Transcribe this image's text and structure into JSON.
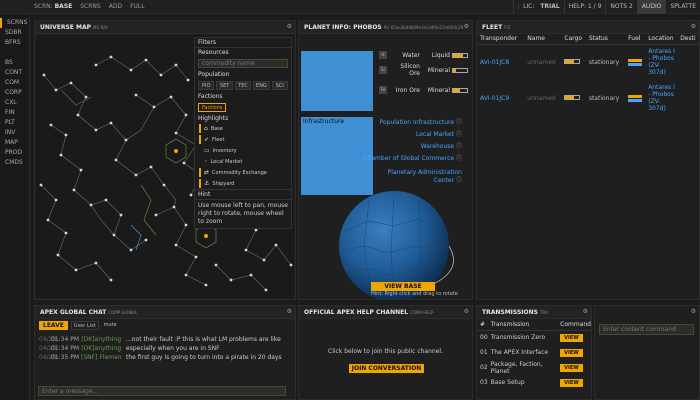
{
  "topbar": {
    "screen_prefix": "SCRN:",
    "screen_name": "BASE",
    "buttons": [
      "SCRNS",
      "ADD",
      "FULL"
    ],
    "right": {
      "lic_prefix": "LIC:",
      "lic": "TRIAL",
      "help": "HELP: 1 / 9",
      "nots": "NOTS 2",
      "audio": "AUDIO",
      "splatter": "SPLATTE"
    }
  },
  "sidebar": {
    "group1": [
      "SCRNS",
      "SDBR",
      "BFRS"
    ],
    "group2": [
      "BS",
      "CONT",
      "COM",
      "CORP",
      "CXL",
      "FIN",
      "PLT",
      "INV",
      "MAP",
      "PROD",
      "CMDS"
    ]
  },
  "universe": {
    "title": "UNIVERSE MAP",
    "subtitle": "MU N/V",
    "filters": {
      "header": "Filters",
      "resources_label": "Resources",
      "commodity_placeholder": "commodity name",
      "population_label": "Population",
      "pop_buttons": [
        "PIO",
        "SET",
        "TEC",
        "ENG",
        "SCI"
      ],
      "factions_label": "Factions",
      "factions_button": "Factions",
      "highlights_label": "Highlights",
      "highlights": [
        "Base",
        "Fleet",
        "Inventory",
        "Local Market",
        "Commodity Exchange",
        "Shipyard"
      ],
      "hint_label": "Hint",
      "hint_text": "Use mouse left to pan, mouse right to rotate, mouse wheel to zoom"
    }
  },
  "planet": {
    "title": "PLANET INFO: PHOBOS",
    "subtitle": "PLI 65ae2bd4b09e1ec3df0e15c6fd4c29",
    "resources": [
      {
        "name": "Water",
        "type": "Liquid",
        "level": 0.7
      },
      {
        "name": "Silicon Ore",
        "type": "Mineral",
        "level": 0.2
      },
      {
        "name": "Iron Ore",
        "type": "Mineral",
        "level": 0.5
      }
    ],
    "infrastructure_label": "Infrastructure",
    "infrastructure": [
      "Population Infrastructure",
      "Local Market",
      "Warehouse",
      "Chamber of Global Commerce",
      "Planetary Administration Center"
    ],
    "view_base": "VIEW BASE",
    "globe_hint": "Hint: Right click and drag to rotate"
  },
  "fleet": {
    "title": "FLEET",
    "subtitle": "FLT",
    "columns": [
      "Transponder",
      "Name",
      "Cargo",
      "Status",
      "Fuel",
      "Location",
      "Desti"
    ],
    "rows": [
      {
        "transponder": "AVI-01JC8",
        "name": "unnamed",
        "cargo": 0.6,
        "status": "stationary",
        "location": "Antares I - Phobos (ZV-307d)"
      },
      {
        "transponder": "AVI-01JC9",
        "name": "unnamed",
        "cargo": 0.6,
        "status": "stationary",
        "location": "Antares I - Phobos (ZV-307d)"
      }
    ]
  },
  "chat": {
    "title": "APEX GLOBAL CHAT",
    "subtitle": "COMP GLOBAL",
    "leave": "LEAVE",
    "user_list": "User List",
    "mute": "mute",
    "messages": [
      {
        "date": "04/23",
        "time": "01:34 PM",
        "user": "[DK]anything",
        "text": "...not their fault :P this is what LM problems are like"
      },
      {
        "date": "04/23",
        "time": "01:34 PM",
        "user": "[DK]anything",
        "text": "especially when you are in SNF"
      },
      {
        "date": "04/23",
        "time": "01:35 PM",
        "user": "[SNF] Fleman",
        "text": "the first guy is going to turn into a pirate in 20 days"
      }
    ],
    "input_placeholder": "Enter a message..."
  },
  "help": {
    "title": "OFFICIAL APEX HELP CHANNEL",
    "subtitle": "COMP HELP",
    "text": "Click below to join this public channel.",
    "button": "JOIN CONVERSATION"
  },
  "transmissions": {
    "title": "TRANSMISSIONS",
    "subtitle": "TRA",
    "columns": [
      "#",
      "Transmission",
      "Command"
    ],
    "rows": [
      {
        "num": "00",
        "name": "Transmission Zero",
        "cmd": "VIEW"
      },
      {
        "num": "01",
        "name": "The APEX Interface",
        "cmd": "VIEW"
      },
      {
        "num": "02",
        "name": "Package, Faction, Planet",
        "cmd": "VIEW"
      },
      {
        "num": "03",
        "name": "Base Setup",
        "cmd": "VIEW"
      }
    ]
  },
  "command": {
    "placeholder": "Enter content command"
  },
  "colors": {
    "accent": "#f0a500",
    "link": "#4aa3ff",
    "planet_blue": "#3e8fd4"
  }
}
